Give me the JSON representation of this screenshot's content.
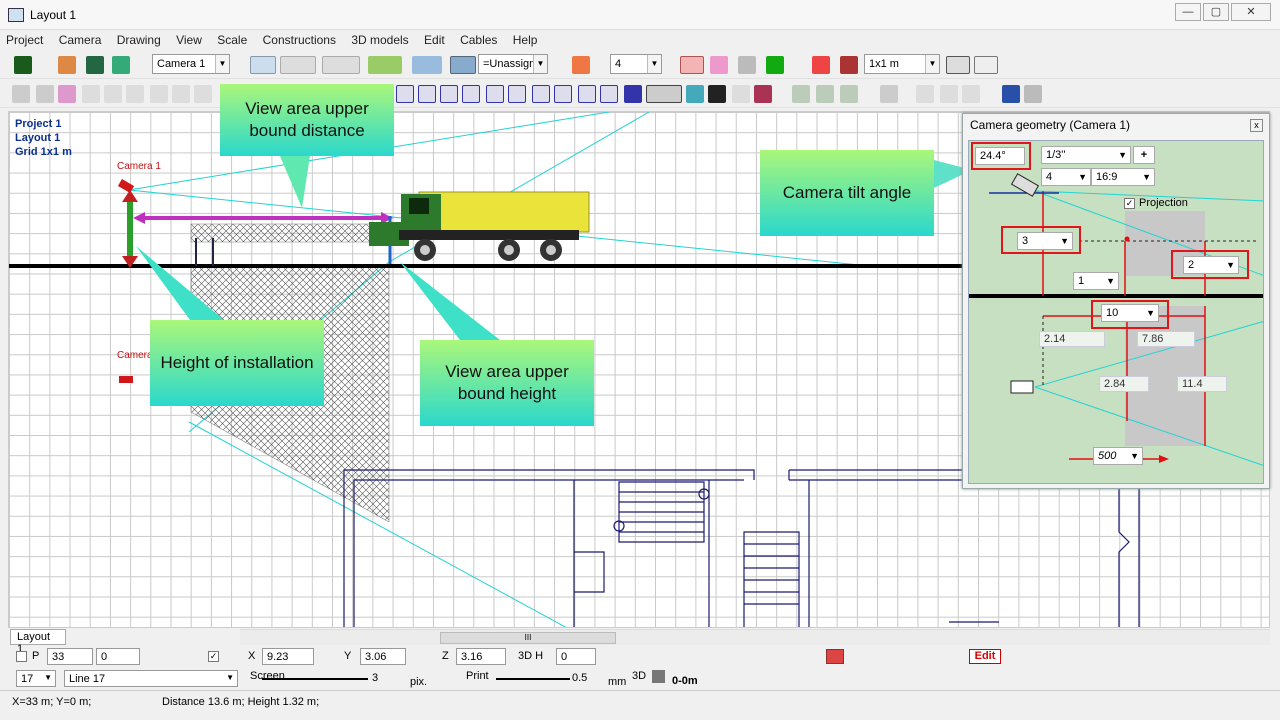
{
  "window": {
    "title": "Layout 1",
    "min": "—",
    "max": "▢",
    "close": "✕"
  },
  "menu": [
    "Project",
    "Camera",
    "Drawing",
    "View",
    "Scale",
    "Constructions",
    "3D models",
    "Edit",
    "Cables",
    "Help"
  ],
  "toolbar": {
    "camera_select": "Camera 1",
    "unassigned_select": "=Unassigne",
    "number_select": "4",
    "grid_select": "1x1 m"
  },
  "project_info": {
    "project": "Project 1",
    "layout": "Layout 1",
    "grid": "Grid 1x1 m"
  },
  "canvas_labels": {
    "camera1": "Camera 1",
    "camera2": "Camera"
  },
  "callouts": {
    "upper_distance": "View area upper bound distance",
    "tilt": "Camera tilt angle",
    "height_install": "Height of installation",
    "upper_height": "View area upper bound height"
  },
  "geometry_panel": {
    "title": "Camera geometry (Camera 1)",
    "close": "x",
    "tilt_angle": "24.4°",
    "sensor": "1/3''",
    "plus": "+",
    "focal": "4",
    "aspect": "16:9",
    "projection_label": "Projection",
    "projection_checked": true,
    "install_height": "3",
    "upper_height": "2",
    "lower_height": "1",
    "distance": "10",
    "near_dist": "2.14",
    "far_dist": "7.86",
    "near_width": "2.84",
    "far_width": "11.4",
    "resolution": "500"
  },
  "bottom": {
    "tab": "Layout 1",
    "scroll_grip": "III",
    "p_label": "P",
    "p_value": "33",
    "p_value2": "0",
    "x_label": "X",
    "x_value": "9.23",
    "y_label": "Y",
    "y_value": "3.06",
    "z_label": "Z",
    "z_value": "3.16",
    "h3d_label": "3D H",
    "h3d_value": "0",
    "edit": "Edit",
    "line_num": "17",
    "line_name": "Line 17",
    "screen_label": "Screen",
    "screen_value": "3",
    "pix_label": "pix.",
    "print_label": "Print",
    "print_value": "0.5",
    "mm_label": "mm",
    "d3_label": "3D",
    "range_label": "0-0m"
  },
  "statusbar": {
    "coords": "X=33 m; Y=0 m;",
    "info": "Distance 13.6 m; Height 1.32 m;"
  }
}
